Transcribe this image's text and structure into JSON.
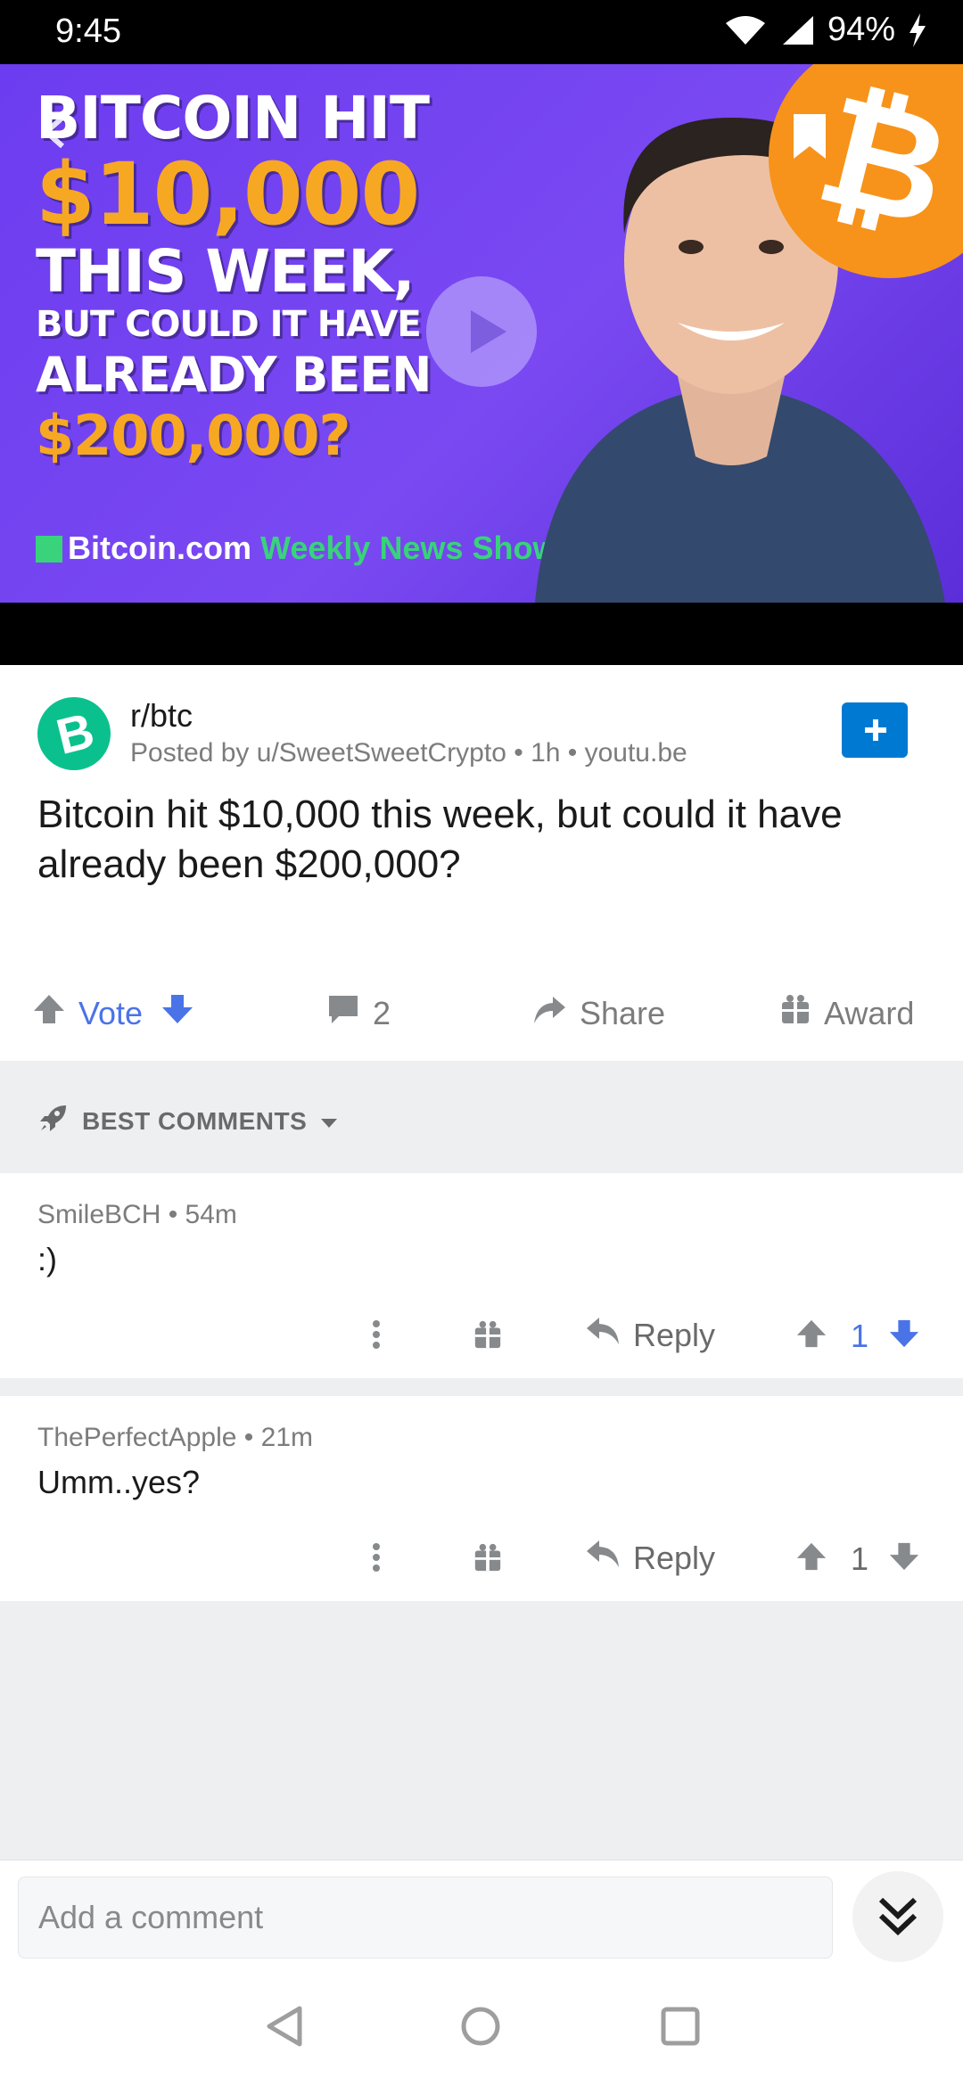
{
  "status_bar": {
    "time": "9:45",
    "battery": "94%"
  },
  "video": {
    "headline": [
      "BITCOIN HIT",
      "$10,000",
      "THIS WEEK,",
      "BUT COULD IT HAVE",
      "ALREADY BEEN",
      "$200,000?"
    ],
    "brand_site": "Bitcoin.com",
    "brand_show": "Weekly News Show",
    "coin_symbol": "₿",
    "accent_color": "#f7a823"
  },
  "post": {
    "subreddit": "r/btc",
    "meta": "Posted by u/SweetSweetCrypto • 1h • youtu.be",
    "title": "Bitcoin hit $10,000 this week, but could it have already been $200,000?",
    "vote_label": "Vote",
    "comment_count": "2",
    "share_label": "Share",
    "award_label": "Award"
  },
  "sort": {
    "label": "BEST COMMENTS"
  },
  "comments": [
    {
      "meta": "SmileBCH • 54m",
      "body": ":)",
      "reply_label": "Reply",
      "score": "1"
    },
    {
      "meta": "ThePerfectApple • 21m",
      "body": "Umm..yes?",
      "reply_label": "Reply",
      "score": "1"
    }
  ],
  "input": {
    "placeholder": "Add a comment"
  },
  "colors": {
    "brand_blue": "#0079d3",
    "vote_blue": "#4a73e8",
    "bch_green": "#0ac18e",
    "btc_orange": "#f7931a"
  }
}
